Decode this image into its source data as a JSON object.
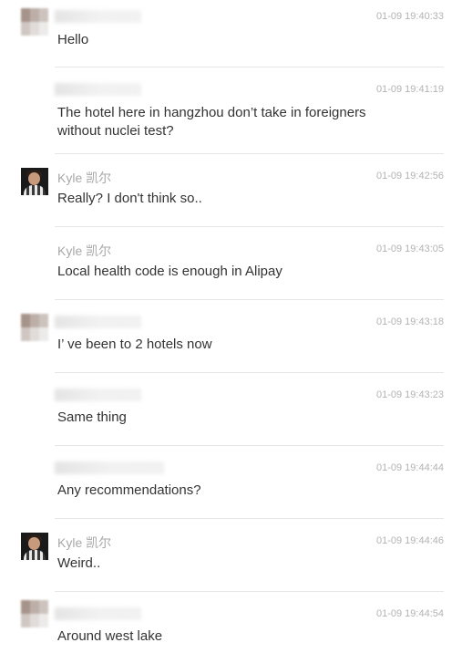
{
  "messages": [
    {
      "sender": "",
      "time": "01-09 19:40:33",
      "text": "Hello"
    },
    {
      "sender": "",
      "time": "01-09 19:41:19",
      "text": "The hotel here in hangzhou don’t take in foreigners without nuclei test?"
    },
    {
      "sender": "Kyle 凯尔",
      "time": "01-09 19:42:56",
      "text": "Really? I don't think so.."
    },
    {
      "sender": "Kyle 凯尔",
      "time": "01-09 19:43:05",
      "text": "Local health code is enough in Alipay"
    },
    {
      "sender": "",
      "time": "01-09 19:43:18",
      "text": "I’ ve been to 2 hotels now"
    },
    {
      "sender": "",
      "time": "01-09 19:43:23",
      "text": "Same thing"
    },
    {
      "sender": "",
      "time": "01-09 19:44:44",
      "text": "Any recommendations?"
    },
    {
      "sender": "Kyle 凯尔",
      "time": "01-09 19:44:46",
      "text": "Weird.."
    },
    {
      "sender": "",
      "time": "01-09 19:44:54",
      "text": "Around west lake"
    }
  ]
}
